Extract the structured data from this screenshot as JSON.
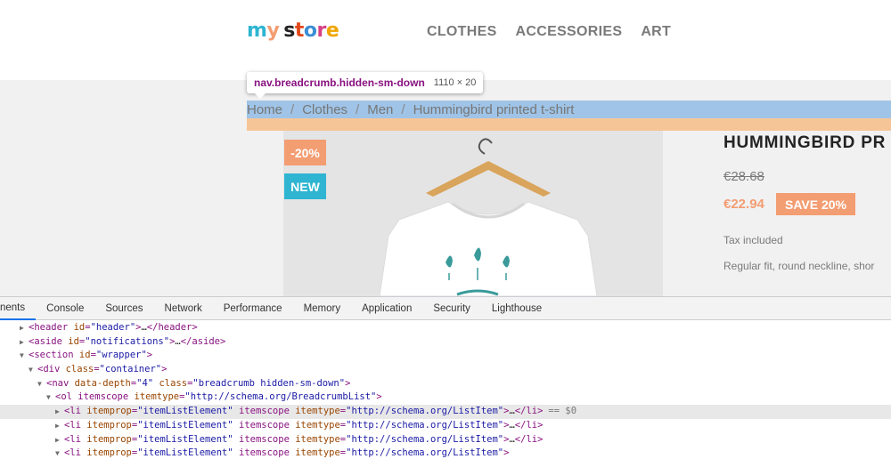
{
  "store": {
    "logo_letters": [
      {
        "ch": "m",
        "color": "#2fb5d2"
      },
      {
        "ch": "y",
        "color": "#f39d72"
      },
      {
        "ch": " ",
        "color": "#ffffff"
      },
      {
        "ch": "s",
        "color": "#232323"
      },
      {
        "ch": "t",
        "color": "#e2491a"
      },
      {
        "ch": "o",
        "color": "#3b8ed4"
      },
      {
        "ch": "r",
        "color": "#d63f84"
      },
      {
        "ch": "e",
        "color": "#f0a500"
      }
    ],
    "nav": [
      "CLOTHES",
      "ACCESSORIES",
      "ART"
    ]
  },
  "inspector_tooltip": {
    "selector": "nav.breadcrumb.hidden-sm-down",
    "size": "1110 × 20"
  },
  "breadcrumb": {
    "items": [
      "Home",
      "Clothes",
      "Men",
      "Hummingbird printed t-shirt"
    ],
    "separator": "/"
  },
  "product": {
    "title": "HUMMINGBIRD PR",
    "badge_discount": "-20%",
    "badge_new": "NEW",
    "old_price": "€28.68",
    "new_price": "€22.94",
    "save_label": "SAVE 20%",
    "tax_note": "Tax included",
    "description": "Regular fit, round neckline, shor"
  },
  "devtools": {
    "tabs": [
      "nents",
      "Console",
      "Sources",
      "Network",
      "Performance",
      "Memory",
      "Application",
      "Security",
      "Lighthouse"
    ],
    "active_tab_index": 0,
    "dom_lines": [
      {
        "indent": 2,
        "tri": "▶",
        "html": "<header id=\"header\">…</header>"
      },
      {
        "indent": 2,
        "tri": "▶",
        "html": "<aside id=\"notifications\">…</aside>"
      },
      {
        "indent": 2,
        "tri": "▼",
        "html": "<section id=\"wrapper\">"
      },
      {
        "indent": 3,
        "tri": "▼",
        "html": "<div class=\"container\">"
      },
      {
        "indent": 4,
        "tri": "▼",
        "html": "<nav data-depth=\"4\" class=\"breadcrumb hidden-sm-down\">"
      },
      {
        "indent": 5,
        "tri": "▼",
        "html": "<ol itemscope itemtype=\"http://schema.org/BreadcrumbList\">"
      },
      {
        "indent": 6,
        "tri": "▶",
        "html": "<li itemprop=\"itemListElement\" itemscope itemtype=\"http://schema.org/ListItem\">…</li>",
        "marker": "== $0",
        "selected": true
      },
      {
        "indent": 6,
        "tri": "▶",
        "html": "<li itemprop=\"itemListElement\" itemscope itemtype=\"http://schema.org/ListItem\">…</li>"
      },
      {
        "indent": 6,
        "tri": "▶",
        "html": "<li itemprop=\"itemListElement\" itemscope itemtype=\"http://schema.org/ListItem\">…</li>"
      },
      {
        "indent": 6,
        "tri": "▼",
        "html": "<li itemprop=\"itemListElement\" itemscope itemtype=\"http://schema.org/ListItem\">"
      }
    ]
  },
  "colors": {
    "accent_orange": "#f39d72",
    "accent_blue": "#2fb5d2",
    "highlight_content": "#9fc4e7",
    "highlight_padding": "#f6c597"
  }
}
